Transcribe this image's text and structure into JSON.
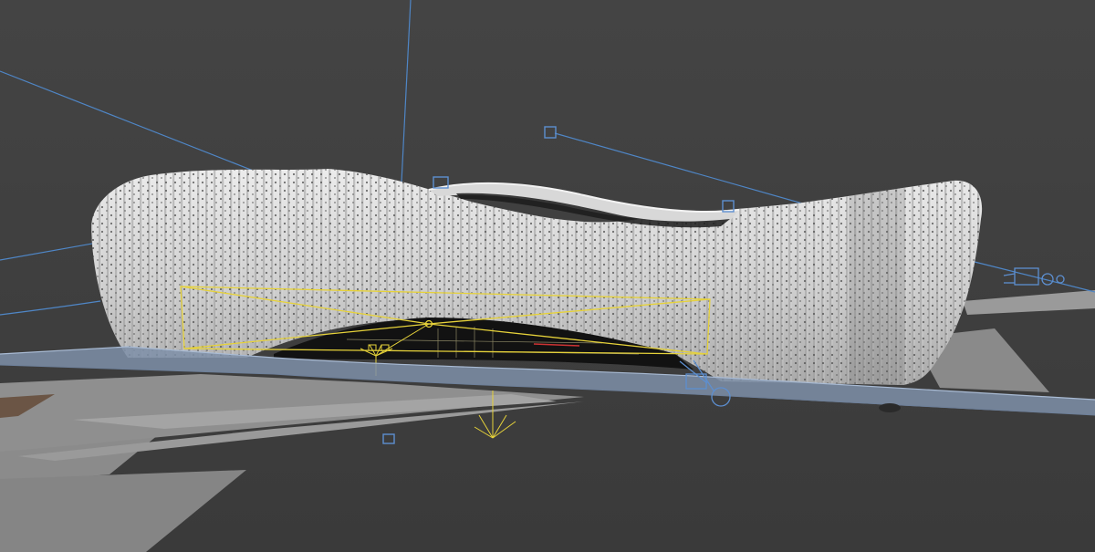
{
  "viewport": {
    "mode": "perspective-3d",
    "background_color": "#3d3d3d"
  },
  "scene": {
    "object": "stadium-facade",
    "facade_color": "#c9c9c9",
    "fin_color": "#a3a3a3",
    "perforation_color": "#4a4a4a",
    "ground_color": "#8e8e8e",
    "road_color": "#7e8fa8",
    "selection_color": "#e6d23a",
    "light_helper_color": "#4f86c6",
    "interior_color": "#121212"
  }
}
